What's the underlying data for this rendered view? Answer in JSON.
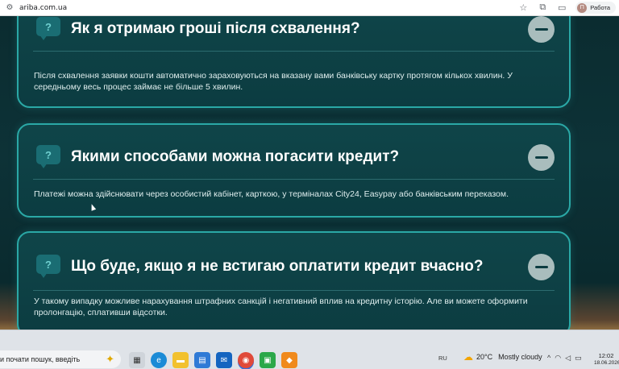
{
  "browser": {
    "url": "ariba.com.ua",
    "profile_initial": "П",
    "profile_label": "Работа",
    "tune_icon": "site-settings-icon",
    "star_icon": "bookmark-star-icon",
    "extensions_icon": "extensions-icon",
    "sidebar_icon": "side-panel-icon"
  },
  "faq": [
    {
      "title": "Як я отримаю гроші після схвалення?",
      "answer": "Після схвалення заявки кошти автоматично зараховуються на вказану вами банківську картку протягом кількох хвилин. У середньому весь процес займає не більше 5 хвилин.",
      "expanded": true
    },
    {
      "title": "Якими способами можна погасити кредит?",
      "answer": "Платежі можна здійснювати через особистий кабінет, карткою, у терміналах City24, Easypay або банківським переказом.",
      "expanded": true
    },
    {
      "title": "Що буде, якщо я не встигаю оплатити кредит вчасно?",
      "answer": "У такому випадку можливе нарахування штрафних санкцій і негативний вплив на кредитну історію. Але ви можете оформити пролонгацію, сплативши відсотки.",
      "expanded": true
    }
  ],
  "faq_icon_glyph": "?",
  "taskbar": {
    "search_text": "и почати пошук, введіть",
    "language": "RU",
    "weather_temp": "20°C",
    "weather_desc": "Mostly cloudy",
    "time": "12:02",
    "date": "18.06.2026"
  },
  "colors": {
    "accent_border": "#2aa8a6",
    "card_bg": "#0f4549",
    "page_bg": "#0c2a2e"
  }
}
